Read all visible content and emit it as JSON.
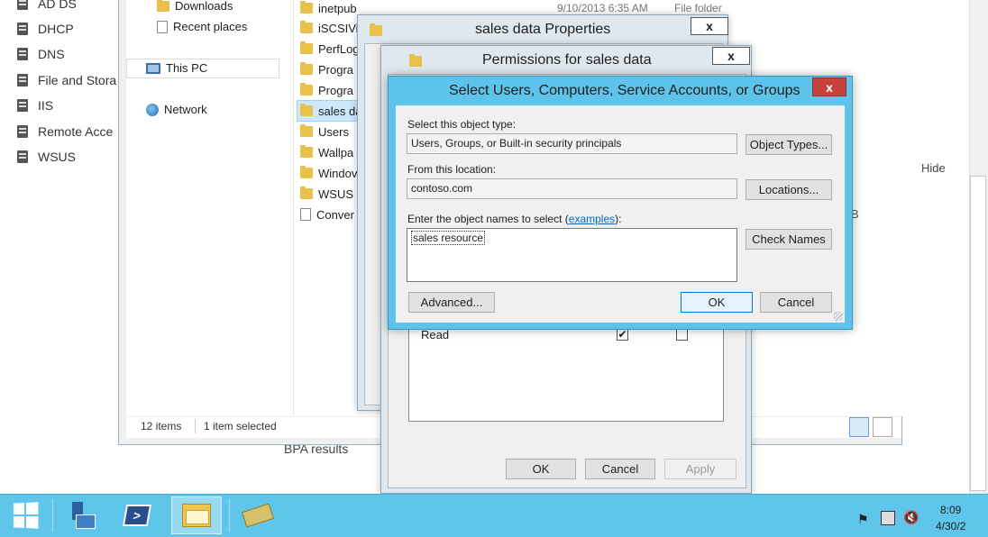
{
  "server_manager": {
    "nav": [
      {
        "label": "AD DS",
        "icon": "ad-ds-icon"
      },
      {
        "label": "DHCP",
        "icon": "dhcp-icon"
      },
      {
        "label": "DNS",
        "icon": "dns-icon"
      },
      {
        "label": "File and Stora",
        "icon": "file-storage-icon"
      },
      {
        "label": "IIS",
        "icon": "iis-icon"
      },
      {
        "label": "Remote Acce",
        "icon": "remote-access-icon"
      },
      {
        "label": "WSUS",
        "icon": "wsus-icon"
      }
    ],
    "hide_label": "Hide",
    "bpa_label": "BPA results",
    "trailing_char": "B"
  },
  "explorer": {
    "nav": [
      {
        "label": "Downloads",
        "icon": "downloads-folder-icon"
      },
      {
        "label": "Recent places",
        "icon": "recent-places-icon"
      },
      {
        "label": "This PC",
        "icon": "this-pc-icon"
      },
      {
        "label": "Network",
        "icon": "network-icon"
      }
    ],
    "files": [
      {
        "name": "inetpub",
        "icon": "folder-icon"
      },
      {
        "name": "iSCSIVi",
        "icon": "folder-icon"
      },
      {
        "name": "PerfLog",
        "icon": "folder-icon"
      },
      {
        "name": "Progra",
        "icon": "folder-icon"
      },
      {
        "name": "Progra",
        "icon": "folder-icon"
      },
      {
        "name": "sales da",
        "icon": "folder-icon"
      },
      {
        "name": "Users",
        "icon": "folder-icon"
      },
      {
        "name": "Wallpa",
        "icon": "folder-icon"
      },
      {
        "name": "Windov",
        "icon": "folder-icon"
      },
      {
        "name": "WSUS",
        "icon": "folder-icon"
      },
      {
        "name": "Conver",
        "icon": "file-icon"
      }
    ],
    "top_row_date": "9/10/2013 6:35 AM",
    "top_row_type": "File folder",
    "status_count": "12 items",
    "status_selected": "1 item selected"
  },
  "properties_dialog": {
    "title": "sales data Properties",
    "close_glyph": "x"
  },
  "permissions_dialog": {
    "title": "Permissions for sales data",
    "close_glyph": "x",
    "permission_row": "Read",
    "allow_checked": true,
    "deny_checked": false,
    "ok_label": "OK",
    "cancel_label": "Cancel",
    "apply_label": "Apply"
  },
  "select_dialog": {
    "title": "Select Users, Computers, Service Accounts, or Groups",
    "close_glyph": "x",
    "object_type_label": "Select this object type:",
    "object_type_value": "Users, Groups, or Built-in security principals",
    "object_types_button": "Object Types...",
    "location_label": "From this location:",
    "location_value": "contoso.com",
    "locations_button": "Locations...",
    "names_label_prefix": "Enter the object names to select (",
    "names_label_link": "examples",
    "names_label_suffix": "):",
    "names_value": "sales resource",
    "check_names_button": "Check Names",
    "advanced_button": "Advanced...",
    "ok_button": "OK",
    "cancel_button": "Cancel"
  },
  "taskbar": {
    "clock_time": "8:09",
    "clock_date": "4/30/2",
    "ps_glyph": ">"
  }
}
